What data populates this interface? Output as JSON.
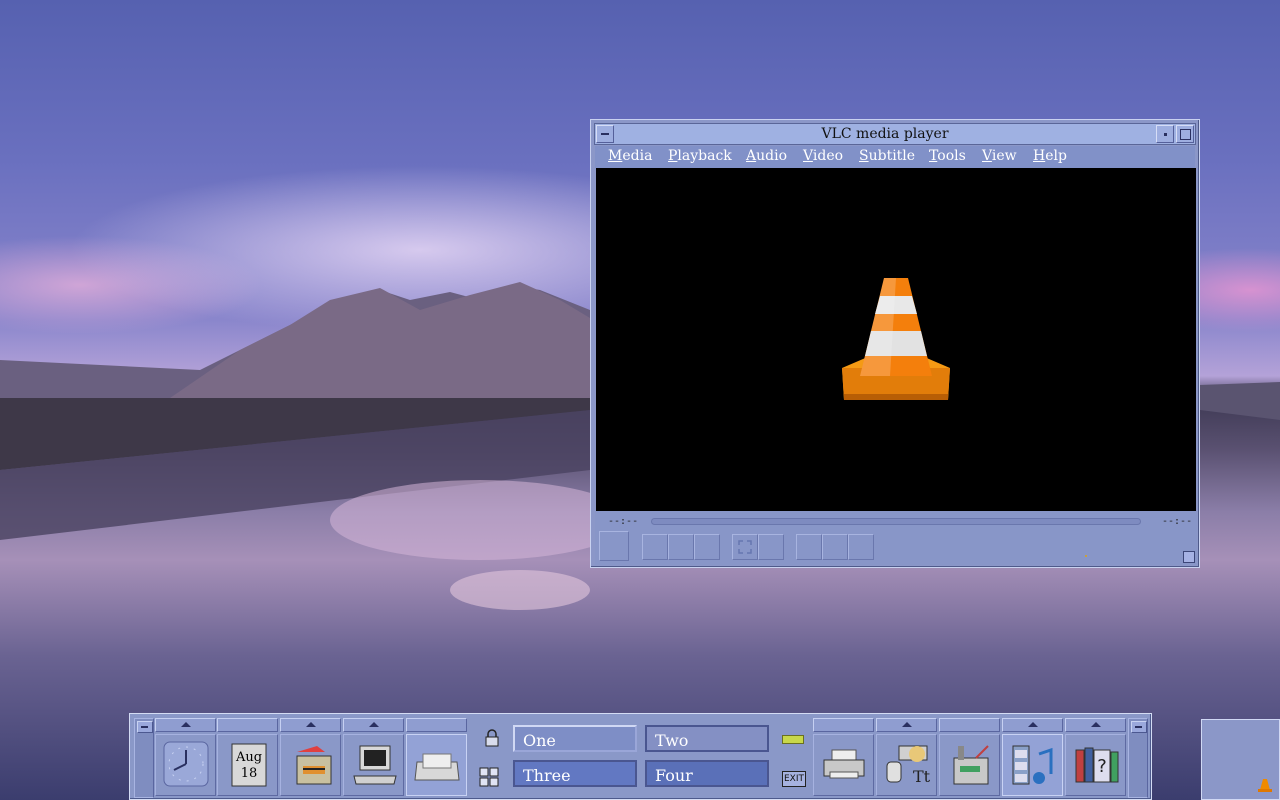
{
  "vlc_window": {
    "title": "VLC media player",
    "menu": [
      "Media",
      "Playback",
      "Audio",
      "Video",
      "Subtitle",
      "Tools",
      "View",
      "Help"
    ],
    "time_elapsed": "--:--",
    "time_total": "--:--"
  },
  "front_panel": {
    "calendar": {
      "month": "Aug",
      "day": "18"
    },
    "workspaces": [
      "One",
      "Two",
      "Three",
      "Four"
    ],
    "exit_label": "EXIT",
    "left_icons": [
      "clock-icon",
      "calendar-icon",
      "file-manager-icon",
      "terminal-icon",
      "mailer-icon"
    ],
    "right_icons": [
      "printer-icon",
      "style-manager-icon",
      "app-manager-icon",
      "media-player-icon",
      "help-manager-icon"
    ]
  },
  "colors": {
    "panel": "#8a98c8",
    "accent_orange": "#f08a00"
  }
}
